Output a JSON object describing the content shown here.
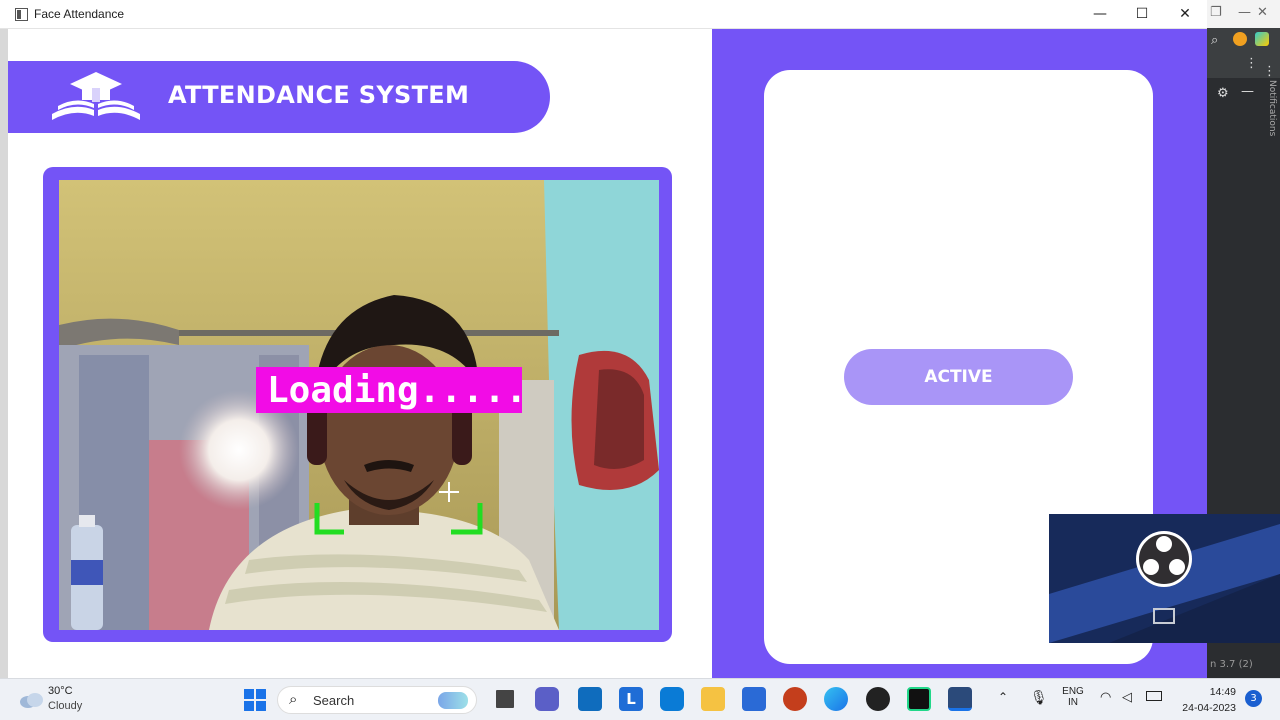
{
  "window": {
    "title": "Face Attendance"
  },
  "header": {
    "title": "ATTENDANCE SYSTEM"
  },
  "camera": {
    "overlay_text": "Loading....."
  },
  "status": {
    "label": "ACTIVE"
  },
  "ide": {
    "notifications_label": "Notifications",
    "status_text": "n 3.7 (2)"
  },
  "taskbar": {
    "weather_temp": "30°C",
    "weather_desc": "Cloudy",
    "search_label": "Search",
    "lang_top": "ENG",
    "lang_bottom": "IN",
    "time": "14:49",
    "date": "24-04-2023",
    "notification_count": "3"
  },
  "colors": {
    "accent": "#7454f6",
    "status_button": "#a995f7",
    "overlay_magenta": "#f20ce6",
    "face_marker": "#22dd22"
  }
}
